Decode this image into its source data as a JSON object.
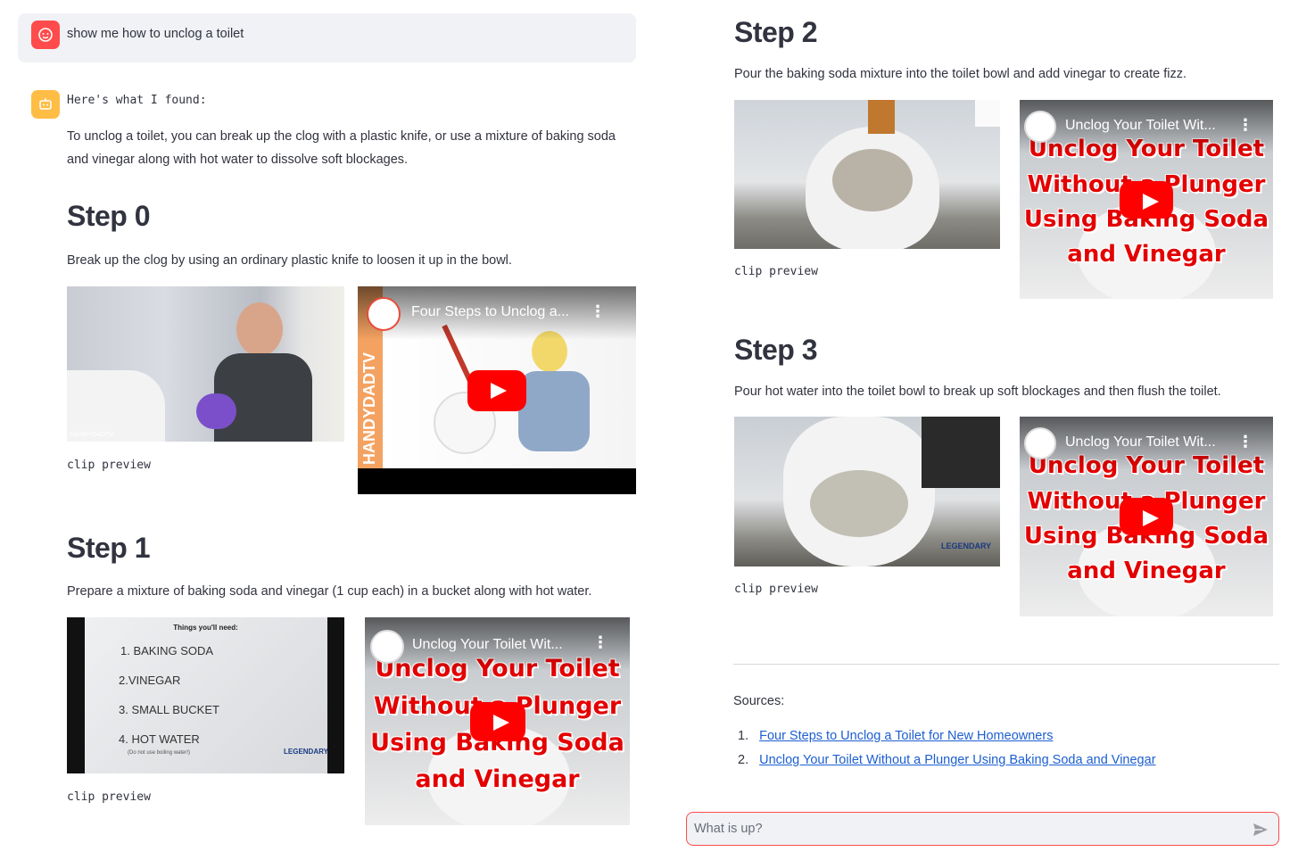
{
  "user_message": {
    "text": "show me how to unclog a toilet"
  },
  "assistant": {
    "found_label": "Here's what I found:",
    "intro": "To unclog a toilet, you can break up the clog with a plastic knife, or use a mixture of baking soda and vinegar along with hot water to dissolve soft blockages."
  },
  "steps": [
    {
      "title": "Step 0",
      "description": "Break up the clog by using an ordinary plastic knife to loosen it up in the bowl.",
      "caption": "clip preview",
      "clip_watermark": "HANDYDADTV",
      "video": {
        "title": "Four Steps to Unclog a...",
        "side_text": "HANDYDADTV"
      }
    },
    {
      "title": "Step 1",
      "description": "Prepare a mixture of baking soda and vinegar (1 cup each) in a bucket along with hot water.",
      "caption": "clip preview",
      "clip_list": {
        "heading": "Things you'll need:",
        "items": [
          "1. BAKING SODA",
          "2.VINEGAR",
          "3. SMALL BUCKET",
          "4. HOT WATER"
        ],
        "note": "(Do not use boiling water!)",
        "logo": "LEGENDARY"
      },
      "video": {
        "title": "Unclog Your Toilet Wit...",
        "thumb_lines": [
          "Unclog Your Toilet",
          "Without a Plunger",
          "Using Baking Soda",
          "and Vinegar"
        ]
      }
    },
    {
      "title": "Step 2",
      "description": "Pour the baking soda mixture into the toilet bowl and add vinegar to create fizz.",
      "caption": "clip preview",
      "video": {
        "title": "Unclog Your Toilet Wit...",
        "thumb_lines": [
          "Unclog Your Toilet",
          "Without a Plunger",
          "Using Baking Soda",
          "and Vinegar"
        ]
      }
    },
    {
      "title": "Step 3",
      "description": "Pour hot water into the toilet bowl to break up soft blockages and then flush the toilet.",
      "caption": "clip preview",
      "clip_logo": "LEGENDARY",
      "video": {
        "title": "Unclog Your Toilet Wit...",
        "thumb_lines": [
          "Unclog Your Toilet",
          "Without a Plunger",
          "Using Baking Soda",
          "and Vinegar"
        ]
      }
    }
  ],
  "sources": {
    "label": "Sources:",
    "items": [
      {
        "num": "1.",
        "text": "Four Steps to Unclog a Toilet for New Homeowners"
      },
      {
        "num": "2.",
        "text": "Unclog Your Toilet Without a Plunger Using Baking Soda and Vinegar"
      }
    ]
  },
  "chat_input": {
    "placeholder": "What is up?"
  },
  "colors": {
    "user_avatar": "#ff4b4b",
    "bot_avatar": "#ffbd45",
    "link": "#1c5fd1",
    "accent": "#ff4b4b"
  },
  "icons": {
    "user_avatar": "face-icon",
    "bot_avatar": "robot-icon",
    "send": "send-icon",
    "play": "play-icon"
  }
}
